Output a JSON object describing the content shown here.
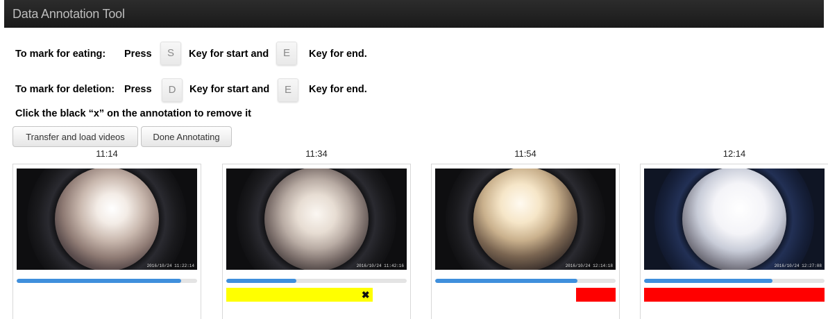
{
  "app": {
    "title": "Data Annotation Tool"
  },
  "instructions": {
    "eating": {
      "label": "To mark for eating:",
      "press": "Press",
      "start_key": "S",
      "start_text": "Key for start and",
      "end_key": "E",
      "end_text": "Key for end."
    },
    "deletion": {
      "label": "To mark for deletion:",
      "press": "Press",
      "start_key": "D",
      "start_text": "Key for start and",
      "end_key": "E",
      "end_text": "Key for end."
    },
    "remove_hint": "Click the black “x” on the annotation to remove it"
  },
  "toolbar": {
    "transfer_label": "Transfer and load videos",
    "done_label": "Done Annotating"
  },
  "colors": {
    "progress": "#3f8fdc",
    "eating_annotation": "#ffff00",
    "deletion_annotation": "#ff0000"
  },
  "clips": [
    {
      "time": "11:14",
      "stamp": "2016/10/24 11:22:14",
      "progress": 0.91,
      "annotations": []
    },
    {
      "time": "11:34",
      "stamp": "2016/10/24 11:42:16",
      "progress": 0.39,
      "annotations": [
        {
          "type": "eating",
          "start": 0.0,
          "end": 0.81,
          "remove_symbol": "✖"
        }
      ]
    },
    {
      "time": "11:54",
      "stamp": "2016/10/24 12:14:18",
      "progress": 0.79,
      "annotations": [
        {
          "type": "deletion",
          "start": 0.78,
          "end": 1.0
        }
      ]
    },
    {
      "time": "12:14",
      "stamp": "2016/10/24 12:27:08",
      "progress": 0.71,
      "annotations": [
        {
          "type": "deletion",
          "start": 0.0,
          "end": 1.0
        }
      ]
    }
  ]
}
